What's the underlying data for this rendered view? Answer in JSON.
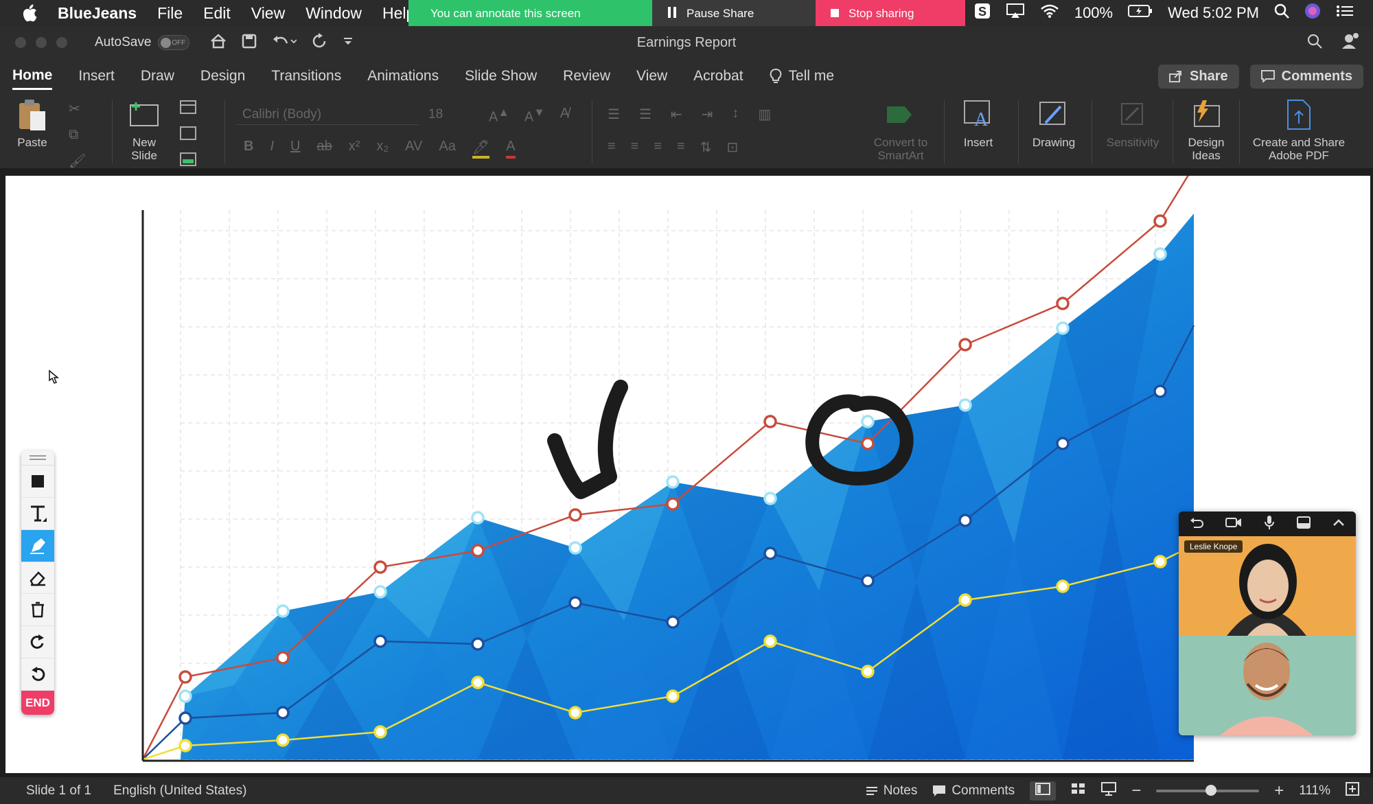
{
  "menubar": {
    "app_name": "BlueJeans",
    "items": [
      "File",
      "Edit",
      "View",
      "Window",
      "Help"
    ],
    "battery": "100%",
    "clock": "Wed 5:02 PM"
  },
  "share_bar": {
    "annotate_text": "You can annotate this screen",
    "pause_label": "Pause Share",
    "stop_label": "Stop sharing"
  },
  "window": {
    "title": "Earnings Report",
    "autosave_label": "AutoSave",
    "autosave_state": "OFF"
  },
  "ribbon_tabs": {
    "tabs": [
      "Home",
      "Insert",
      "Draw",
      "Design",
      "Transitions",
      "Animations",
      "Slide Show",
      "Review",
      "View",
      "Acrobat",
      "Tell me"
    ],
    "active_tab": "Home",
    "share_label": "Share",
    "comments_label": "Comments"
  },
  "ribbon": {
    "paste_label": "Paste",
    "new_slide_label": "New Slide",
    "font_name": "Calibri (Body)",
    "font_size": "18",
    "convert_label": "Convert to SmartArt",
    "insert_label": "Insert",
    "drawing_label": "Drawing",
    "sensitivity_label": "Sensitivity",
    "design_ideas_label": "Design Ideas",
    "create_pdf_label": "Create and Share Adobe PDF"
  },
  "annotation_toolbar": {
    "end_label": "END"
  },
  "video": {
    "participant_name": "Leslie Knope"
  },
  "statusbar": {
    "slide_info": "Slide 1 of 1",
    "language": "English (United States)",
    "notes_label": "Notes",
    "comments_label": "Comments",
    "zoom": "111%"
  },
  "chart_data": {
    "type": "line",
    "title": "",
    "xlabel": "",
    "ylabel": "",
    "x": [
      1,
      2,
      3,
      4,
      5,
      6,
      7,
      8,
      9,
      10,
      11
    ],
    "ylim": [
      0,
      100
    ],
    "series": [
      {
        "color": "#c84b3c",
        "values": [
          15,
          18.5,
          35,
          38,
          44.5,
          46.5,
          61.5,
          57.5,
          75.5,
          83,
          98
        ]
      },
      {
        "color": "#9fe3f5",
        "values": [
          11.5,
          27,
          30.5,
          44,
          38.5,
          50.5,
          47.5,
          61.5,
          64.5,
          78.5,
          92
        ]
      },
      {
        "color": "#1c4f9e",
        "values": [
          7.5,
          8.5,
          21.5,
          21,
          28.5,
          25,
          37.5,
          32.5,
          43.5,
          57.5,
          67
        ]
      },
      {
        "color": "#f2de35",
        "values": [
          2.5,
          3.5,
          5,
          14,
          8.5,
          11.5,
          21.5,
          16,
          29,
          31.5,
          36
        ]
      }
    ],
    "area": {
      "color": "#1580dc",
      "values": [
        11.5,
        27,
        30.5,
        44,
        38.5,
        50.5,
        47.5,
        61.5,
        64.5,
        78.5,
        92
      ]
    }
  },
  "colors": {
    "share_green": "#2ec36b",
    "stop_pink": "#ef3d68",
    "annot_blue": "#2aa3f0"
  }
}
